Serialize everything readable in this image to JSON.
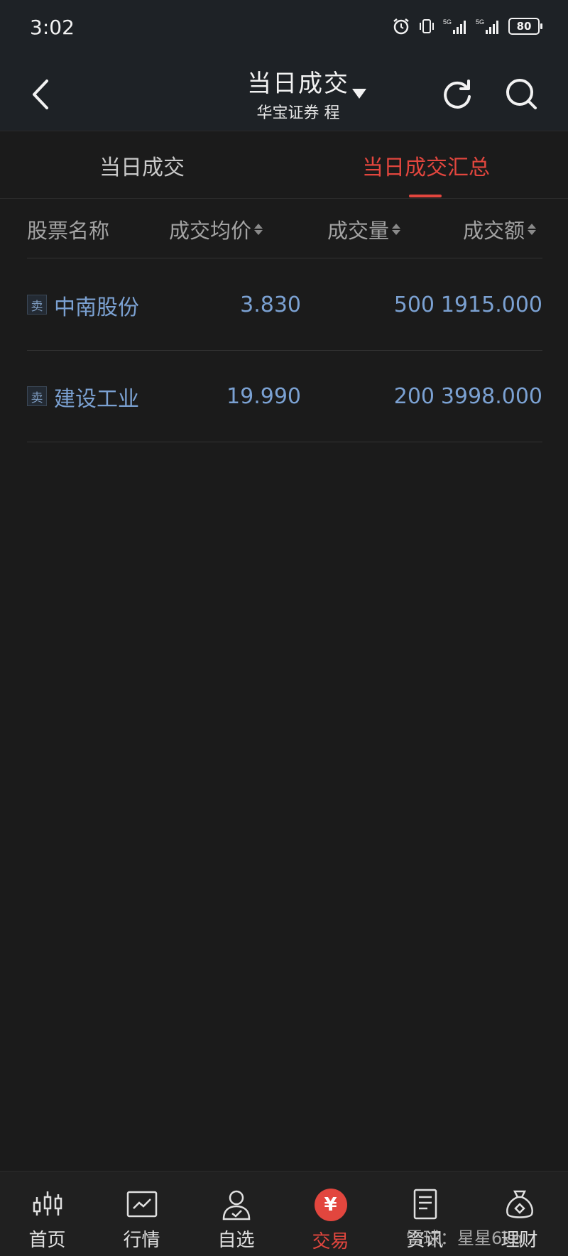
{
  "status_bar": {
    "time": "3:02",
    "battery": "80",
    "signal_icons": [
      "alarm-icon",
      "vibrate-icon",
      "signal-5g-icon",
      "signal-5g-icon"
    ]
  },
  "header": {
    "title": "当日成交",
    "subtitle": "华宝证券 程"
  },
  "tabs": [
    {
      "label": "当日成交",
      "active": false
    },
    {
      "label": "当日成交汇总",
      "active": true
    }
  ],
  "table": {
    "columns": [
      "股票名称",
      "成交均价",
      "成交量",
      "成交额"
    ],
    "rows": [
      {
        "side": "卖",
        "name": "中南股份",
        "avg_price": "3.830",
        "volume": "500",
        "amount": "1915.000"
      },
      {
        "side": "卖",
        "name": "建设工业",
        "avg_price": "19.990",
        "volume": "200",
        "amount": "3998.000"
      }
    ]
  },
  "bottom_nav": [
    {
      "label": "首页",
      "icon": "candlestick-icon"
    },
    {
      "label": "行情",
      "icon": "chart-icon"
    },
    {
      "label": "自选",
      "icon": "user-check-icon"
    },
    {
      "label": "交易",
      "icon": "yuan-icon",
      "active": true
    },
    {
      "label": "资讯",
      "icon": "document-icon"
    },
    {
      "label": "理财",
      "icon": "money-bag-icon"
    }
  ],
  "watermark": "雪球：星星6kq",
  "colors": {
    "accent": "#e2463e",
    "value_blue": "#7ba1d2",
    "background": "#1b1b1b"
  }
}
